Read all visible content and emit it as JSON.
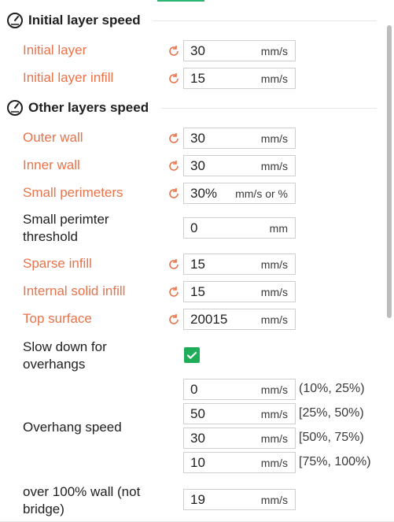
{
  "sections": {
    "initial": {
      "title": "Initial layer speed",
      "icon": "speedometer-icon"
    },
    "other": {
      "title": "Other layers speed",
      "icon": "speedometer-icon"
    }
  },
  "fields": {
    "initial_layer": {
      "label": "Initial layer",
      "value": "30",
      "unit": "mm/s"
    },
    "initial_layer_infill": {
      "label": "Initial layer infill",
      "value": "15",
      "unit": "mm/s"
    },
    "outer_wall": {
      "label": "Outer wall",
      "value": "30",
      "unit": "mm/s"
    },
    "inner_wall": {
      "label": "Inner wall",
      "value": "30",
      "unit": "mm/s"
    },
    "small_perimeters": {
      "label": "Small perimeters",
      "value": "30%",
      "unit": "mm/s or %"
    },
    "small_perimeter_threshold": {
      "label_line1": "Small perimter",
      "label_line2": "threshold",
      "value": "0",
      "unit": "mm"
    },
    "sparse_infill": {
      "label": "Sparse infill",
      "value": "15",
      "unit": "mm/s"
    },
    "internal_solid_infill": {
      "label": "Internal solid infill",
      "value": "15",
      "unit": "mm/s"
    },
    "top_surface": {
      "label": "Top surface",
      "value": "20015",
      "unit": "mm/s"
    },
    "slow_down_overhangs": {
      "label_line1": "Slow down for",
      "label_line2": "overhangs",
      "checked": true
    },
    "overhang_speed": {
      "label": "Overhang speed",
      "rows": [
        {
          "value": "0",
          "unit": "mm/s",
          "range": "(10%, 25%)"
        },
        {
          "value": "50",
          "unit": "mm/s",
          "range": "[25%, 50%)"
        },
        {
          "value": "30",
          "unit": "mm/s",
          "range": "[50%, 75%)"
        },
        {
          "value": "10",
          "unit": "mm/s",
          "range": "[75%, 100%)"
        }
      ]
    },
    "over_100_wall": {
      "label_line1": "over 100% wall (not",
      "label_line2": "bridge)",
      "value": "19",
      "unit": "mm/s"
    }
  },
  "colors": {
    "modified_label": "#e8734a",
    "reset_icon": "#e8734a",
    "checkbox": "#1fad5a"
  }
}
